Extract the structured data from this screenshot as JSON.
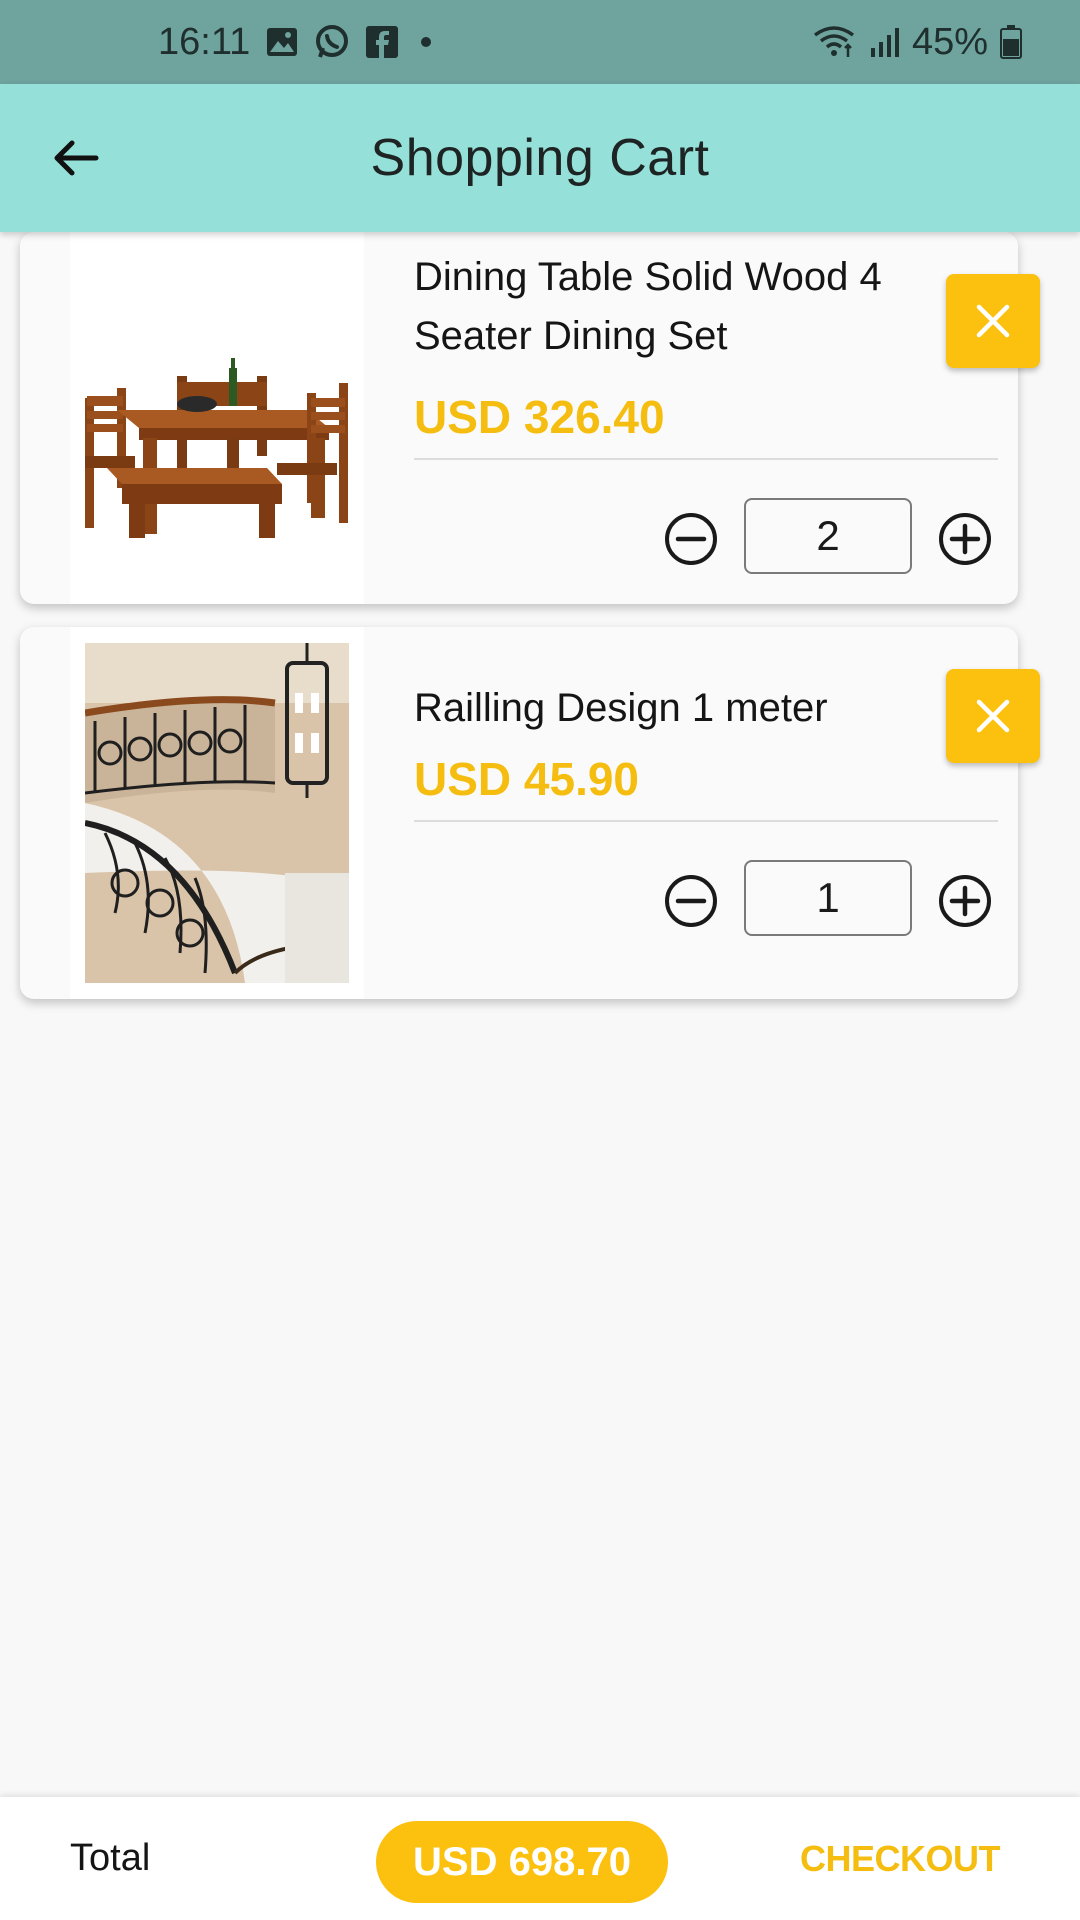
{
  "status_bar": {
    "time": "16:11",
    "battery": "45%",
    "left_icons": [
      "image-icon",
      "whatsapp-icon",
      "facebook-icon",
      "dot-icon"
    ],
    "right_icons": [
      "wifi-icon",
      "signal-icon",
      "battery-icon"
    ]
  },
  "app_bar": {
    "title": "Shopping Cart",
    "back_icon": "arrow-left-icon"
  },
  "cart": {
    "items": [
      {
        "name": "Dining Table Solid Wood 4 Seater Dining Set",
        "price": "USD 326.40",
        "quantity": "2"
      },
      {
        "name": "Railling Design 1 meter",
        "price": "USD 45.90",
        "quantity": "1"
      }
    ]
  },
  "footer": {
    "total_label": "Total",
    "total_value": "USD 698.70",
    "checkout_label": "CHECKOUT"
  },
  "colors": {
    "status_bar": "#6ea39e",
    "app_bar": "#95e0d8",
    "accent": "#fbc10e",
    "background": "#f8f8f8"
  }
}
